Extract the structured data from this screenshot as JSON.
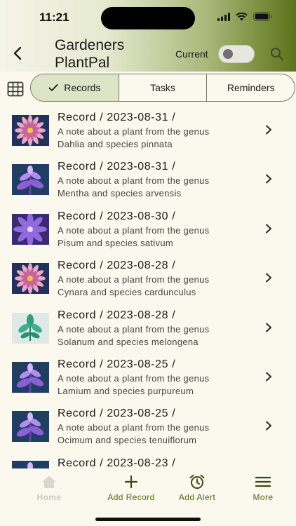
{
  "status": {
    "time": "11:21"
  },
  "header": {
    "title": "Gardeners PlantPal",
    "current_label": "Current"
  },
  "segments": [
    {
      "label": "Records",
      "selected": true
    },
    {
      "label": "Tasks",
      "selected": false
    },
    {
      "label": "Reminders",
      "selected": false
    }
  ],
  "records": [
    {
      "title": "Record / 2023-08-31 /",
      "line1": "A note about a plant from the genus",
      "line2": "Dahlia and species pinnata",
      "thumb": "dahlia-flower"
    },
    {
      "title": "Record / 2023-08-31 /",
      "line1": "A note about a plant from the genus",
      "line2": "Mentha and species arvensis",
      "thumb": "purple-plant"
    },
    {
      "title": "Record / 2023-08-30 /",
      "line1": "A note about a plant from the genus",
      "line2": "Pisum and species sativum",
      "thumb": "violet-flower"
    },
    {
      "title": "Record / 2023-08-28 /",
      "line1": "A note about a plant from the genus",
      "line2": "Cynara and species cardunculus",
      "thumb": "dahlia-flower"
    },
    {
      "title": "Record / 2023-08-28 /",
      "line1": "A note about a plant from the genus",
      "line2": "Solanum and species melongena",
      "thumb": "green-leaves"
    },
    {
      "title": "Record / 2023-08-25 /",
      "line1": "A note about a plant from the genus",
      "line2": "Lamium and species purpureum",
      "thumb": "purple-plant"
    },
    {
      "title": "Record / 2023-08-25 /",
      "line1": "A note about a plant from the genus",
      "line2": "Ocimum and species tenuiflorum",
      "thumb": "purple-plant"
    },
    {
      "title": "Record / 2023-08-23 /",
      "line1": "",
      "line2": "",
      "thumb": "purple-plant"
    }
  ],
  "nav": [
    {
      "label": "Home",
      "icon": "home-icon",
      "disabled": true
    },
    {
      "label": "Add Record",
      "icon": "plus-icon",
      "disabled": false
    },
    {
      "label": "Add Alert",
      "icon": "alarm-clock-icon",
      "disabled": false
    },
    {
      "label": "More",
      "icon": "menu-icon",
      "disabled": false
    }
  ],
  "colors": {
    "accent": "#4c6a12",
    "selected_segment": "#dce5c6",
    "background": "#fbf8ee"
  }
}
